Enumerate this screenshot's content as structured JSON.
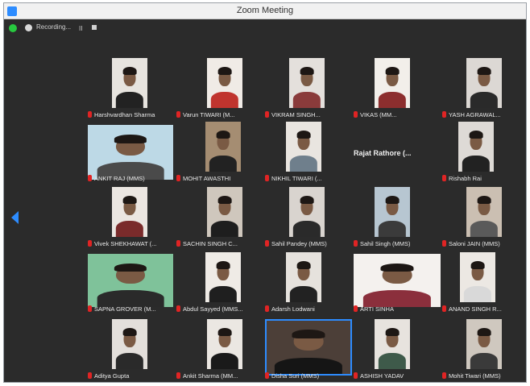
{
  "window": {
    "title": "Zoom Meeting"
  },
  "toolbar": {
    "recording_label": "Recording...",
    "pause_label": "II"
  },
  "participants": [
    {
      "name": "Harshvardhan Sharma",
      "bg": "#e7e4df",
      "shirt": "#222222"
    },
    {
      "name": "Varun TIWARI (M...",
      "bg": "#f0ebe6",
      "shirt": "#c0342e"
    },
    {
      "name": "VIKRAM SINGH...",
      "bg": "#e4e0dc",
      "shirt": "#8a3b3b"
    },
    {
      "name": "VIKAS (MM...",
      "bg": "#f2efea",
      "shirt": "#8c2e2e"
    },
    {
      "name": "YASH AGRAWAL...",
      "bg": "#dcd8d4",
      "shirt": "#2a2a2a"
    },
    {
      "name": "ANKIT RAJ (MMS)",
      "bg": "#bdd9e6",
      "shirt": "#4a4a4a"
    },
    {
      "name": "MOHIT AWASTHI",
      "bg": "#a58d72",
      "shirt": "#222222"
    },
    {
      "name": "NIKHIL TIWARI (...",
      "bg": "#e9e5e0",
      "shirt": "#6f7f8c"
    },
    {
      "name": "Rajat Rathore (...",
      "bg": "#2b2b2b",
      "shirt": "#2b2b2b",
      "no_video": true
    },
    {
      "name": "Rishabh Rai",
      "bg": "#dedad6",
      "shirt": "#222222"
    },
    {
      "name": "Vivek SHEKHAWAT (...",
      "bg": "#ebe6e1",
      "shirt": "#7a2b2b"
    },
    {
      "name": "SACHIN SINGH C...",
      "bg": "#cfc7bd",
      "shirt": "#1e1e1e"
    },
    {
      "name": "Sahil Pandey (MMS)",
      "bg": "#d9d4cf",
      "shirt": "#2a2a2a"
    },
    {
      "name": "Sahil Singh (MMS)",
      "bg": "#b7c6d1",
      "shirt": "#3b3b3b"
    },
    {
      "name": "Saloni JAIN (MMS)",
      "bg": "#cbbfb2",
      "shirt": "#5a5a5a"
    },
    {
      "name": "SAPNA GROVER (M...",
      "bg": "#7fc29a",
      "shirt": "#2a2a2a"
    },
    {
      "name": "Abdul Sayyed (MMS...",
      "bg": "#efebe6",
      "shirt": "#1f1f1f"
    },
    {
      "name": "Adarsh Lodwani",
      "bg": "#e6e2dd",
      "shirt": "#222222"
    },
    {
      "name": "ARTI SINHA",
      "bg": "#f4f1ee",
      "shirt": "#8b2f3c"
    },
    {
      "name": "ANAND SINGH R...",
      "bg": "#ece8e3",
      "shirt": "#d9d9d9"
    },
    {
      "name": "Aditya Gupta",
      "bg": "#e3dfdb",
      "shirt": "#2a2a2a"
    },
    {
      "name": "Ankit Sharma (MM...",
      "bg": "#ebe7e2",
      "shirt": "#1a1a1a"
    },
    {
      "name": "Disha Suri (MMS)",
      "bg": "#4c3f38",
      "shirt": "#151515",
      "active": true
    },
    {
      "name": "ASHISH YADAV",
      "bg": "#e7e3de",
      "shirt": "#3e5a4a"
    },
    {
      "name": "Mohit Tiwari (MMS)",
      "bg": "#cfc8bf",
      "shirt": "#3a3a3a"
    }
  ]
}
